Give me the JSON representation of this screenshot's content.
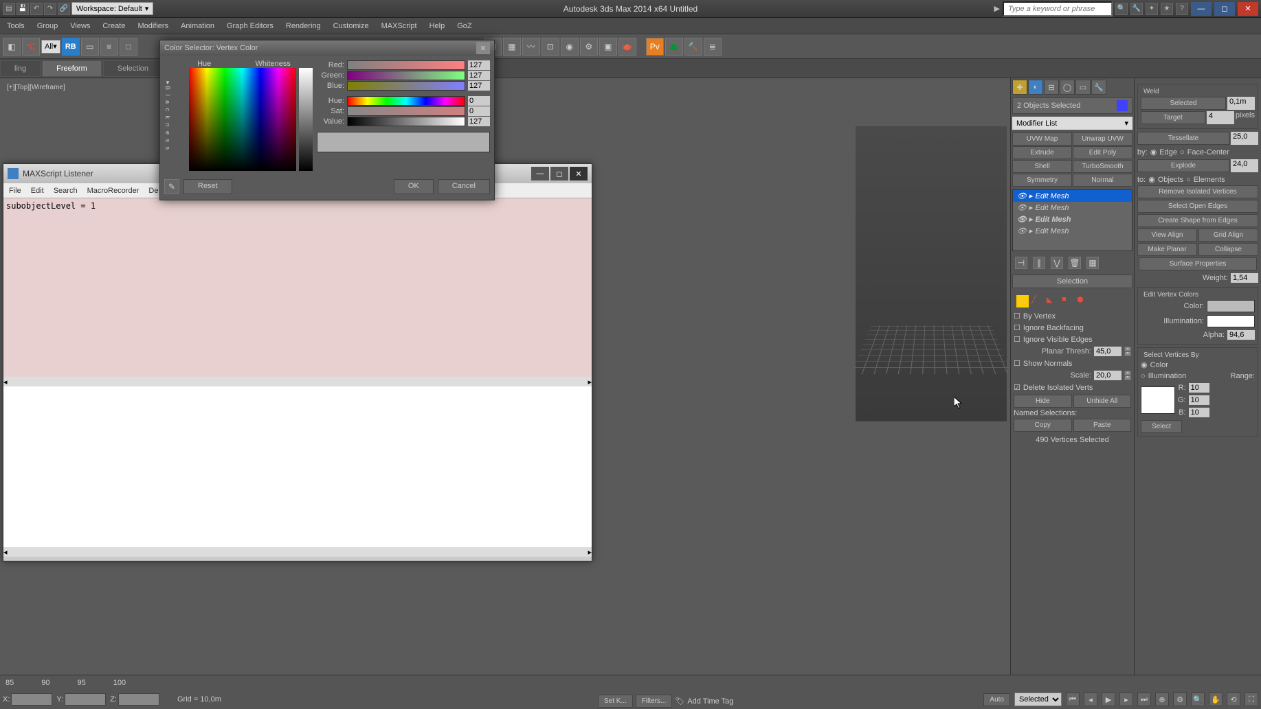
{
  "title": "Autodesk 3ds Max  2014 x64   Untitled",
  "workspace_label": "Workspace: Default",
  "search_placeholder": "Type a keyword or phrase",
  "menus": [
    "Tools",
    "Group",
    "Views",
    "Create",
    "Modifiers",
    "Animation",
    "Graph Editors",
    "Rendering",
    "Customize",
    "MAXScript",
    "Help",
    "GoZ"
  ],
  "toolbar_dd": "All",
  "ribbon": {
    "tab1": "ling",
    "tab2": "Freeform",
    "tab3": "Selection"
  },
  "viewport_label": "[+][Top][Wireframe]",
  "listener": {
    "title": "MAXScript Listener",
    "menus": [
      "File",
      "Edit",
      "Search",
      "MacroRecorder",
      "De"
    ],
    "content": "subobjectLevel = 1"
  },
  "color_dlg": {
    "title": "Color Selector: Vertex Color",
    "hue_label": "Hue",
    "whiteness_label": "Whiteness",
    "blackness": "B l a c k n e s s",
    "red": "Red:",
    "red_v": "127",
    "green": "Green:",
    "green_v": "127",
    "blue": "Blue:",
    "blue_v": "127",
    "hue": "Hue:",
    "hue_v": "0",
    "sat": "Sat:",
    "sat_v": "0",
    "value": "Value:",
    "value_v": "127",
    "reset": "Reset",
    "ok": "OK",
    "cancel": "Cancel"
  },
  "cmd": {
    "sel_count": "2 Objects Selected",
    "mod_list": "Modifier List",
    "mods": [
      "UVW Map",
      "Unwrap UVW",
      "Extrude",
      "Edit Poly",
      "Shell",
      "TurboSmooth",
      "Symmetry",
      "Normal"
    ],
    "stack": [
      "Edit Mesh",
      "Edit Mesh",
      "Edit Mesh",
      "Edit Mesh"
    ],
    "selection_hdr": "Selection",
    "by_vertex": "By Vertex",
    "ignore_back": "Ignore Backfacing",
    "ignore_vis": "Ignore Visible Edges",
    "planar": "Planar Thresh:",
    "planar_v": "45,0",
    "show_norm": "Show Normals",
    "scale": "Scale:",
    "scale_v": "20,0",
    "del_iso": "Delete Isolated Verts",
    "hide": "Hide",
    "unhide": "Unhide All",
    "named": "Named Selections:",
    "copy": "Copy",
    "paste": "Paste",
    "verts_sel": "490 Vertices Selected"
  },
  "side": {
    "weld": "Weld",
    "selected": "Selected",
    "selected_v": "0,1m",
    "target": "Target",
    "target_v": "4",
    "pixels": "pixels",
    "tessellate": "Tessellate",
    "tess_v": "25,0",
    "by": "by:",
    "edge": "Edge",
    "facecenter": "Face-Center",
    "explode": "Explode",
    "exp_v": "24,0",
    "to": "to:",
    "objects": "Objects",
    "elements": "Elements",
    "rem_iso": "Remove Isolated Vertices",
    "sel_open": "Select Open Edges",
    "create_shape": "Create Shape from Edges",
    "view_align": "View Align",
    "grid_align": "Grid Align",
    "make_planar": "Make Planar",
    "collapse": "Collapse",
    "surf_prop": "Surface Properties",
    "weight": "Weight:",
    "weight_v": "1,54",
    "edit_vc": "Edit Vertex Colors",
    "color": "Color:",
    "illum": "Illumination:",
    "alpha": "Alpha:",
    "alpha_v": "94,6",
    "sel_vert_by": "Select Vertices By",
    "color_r": "Color",
    "illum_r": "Illumination",
    "range": "Range:",
    "r": "R:",
    "r_v": "10",
    "g": "G:",
    "g_v": "10",
    "b": "B:",
    "b_v": "10",
    "select": "Select"
  },
  "status": {
    "x": "X:",
    "y": "Y:",
    "z": "Z:",
    "grid": "Grid = 10,0m",
    "auto": "Auto",
    "selected": "Selected",
    "set_k": "Set K...",
    "filters": "Filters...",
    "add_tag": "Add Time Tag",
    "frames": [
      "85",
      "90",
      "95",
      "100"
    ]
  }
}
